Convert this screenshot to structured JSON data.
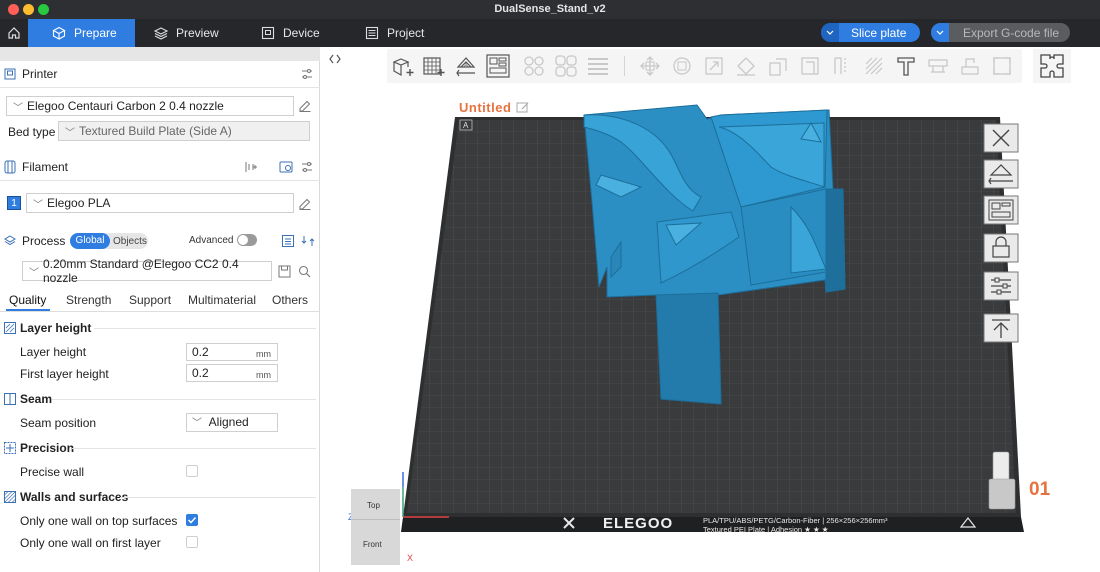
{
  "window": {
    "title": "DualSense_Stand_v2",
    "traffic_colors": [
      "#ff5f57",
      "#febc2e",
      "#28c840"
    ]
  },
  "nav": {
    "tabs": [
      {
        "label": "Prepare",
        "icon": "cube-icon",
        "active": true
      },
      {
        "label": "Preview",
        "icon": "layers-icon",
        "active": false
      },
      {
        "label": "Device",
        "icon": "device-icon",
        "active": false
      },
      {
        "label": "Project",
        "icon": "project-icon",
        "active": false
      }
    ],
    "slice_label": "Slice plate",
    "export_label": "Export G-code file",
    "accent": "#2f7de1"
  },
  "printer": {
    "header": "Printer",
    "selected": "Elegoo Centauri Carbon 2 0.4 nozzle",
    "bed_type_label": "Bed type",
    "bed_type_value": "Textured Build Plate (Side A)"
  },
  "filament": {
    "header": "Filament",
    "slot": "1",
    "selected": "Elegoo PLA"
  },
  "process": {
    "header": "Process",
    "global_label": "Global",
    "objects_label": "Objects",
    "advanced_label": "Advanced",
    "advanced_on": false,
    "preset": "0.20mm Standard @Elegoo CC2 0.4 nozzle"
  },
  "settings_tabs": [
    "Quality",
    "Strength",
    "Support",
    "Multimaterial",
    "Others"
  ],
  "settings": {
    "layer_height_group": "Layer height",
    "layer_height_label": "Layer height",
    "layer_height_value": "0.2",
    "first_layer_label": "First layer height",
    "first_layer_value": "0.2",
    "unit_mm": "mm",
    "seam_group": "Seam",
    "seam_position_label": "Seam position",
    "seam_position_value": "Aligned",
    "precision_group": "Precision",
    "precise_wall_label": "Precise wall",
    "precise_wall_checked": false,
    "walls_group": "Walls and surfaces",
    "one_wall_top_label": "Only one wall on top surfaces",
    "one_wall_top_checked": true,
    "one_wall_first_label": "Only one wall on first layer",
    "one_wall_first_checked": false
  },
  "viewport": {
    "plate_name": "Untitled",
    "plate_number": "01",
    "plate_tag": "A",
    "bed_brand": "ELEGOO",
    "bed_spec_line1": "PLA/TPU/ABS/PETG/Carbon-Fiber | 256×256×256mm³",
    "bed_spec_line2": "Textured PEI Plate | Adhesion ★ ★ ★",
    "cube_top": "Top",
    "cube_front": "Front",
    "axis_z": "Z",
    "axis_x": "X",
    "model_color": "#2b8fc4",
    "bed_color": "#3b3c3e"
  }
}
